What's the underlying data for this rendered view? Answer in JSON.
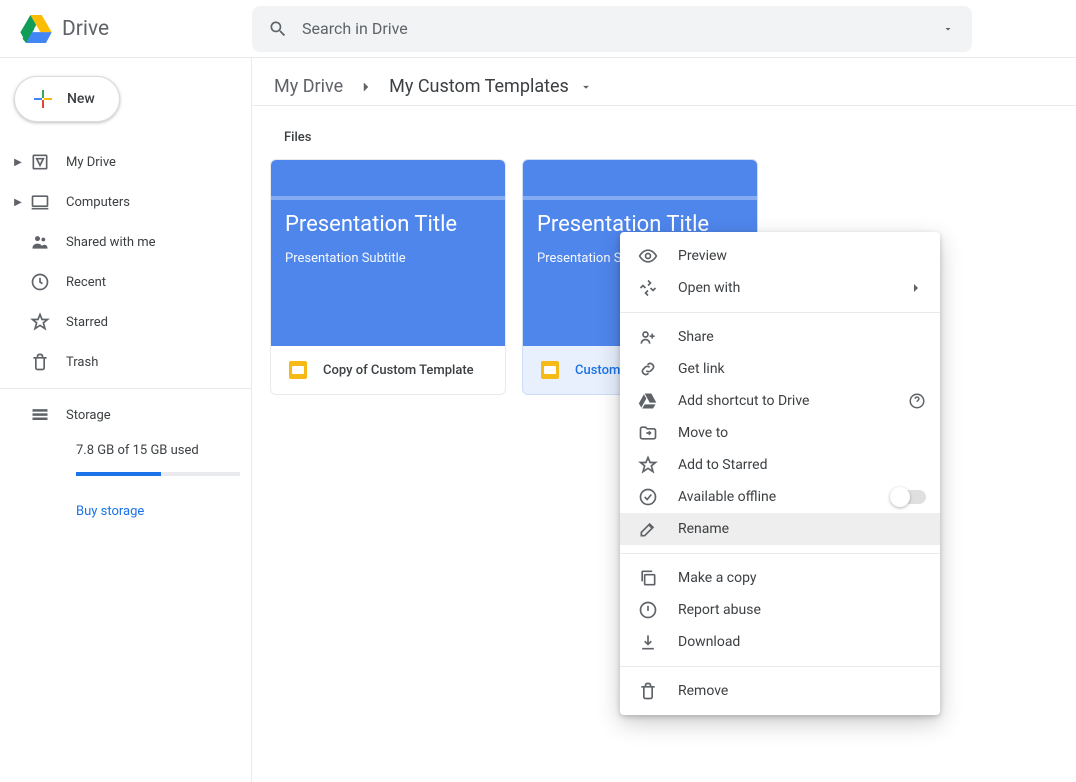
{
  "header": {
    "logo_text": "Drive",
    "search_placeholder": "Search in Drive"
  },
  "sidebar": {
    "new_label": "New",
    "items": [
      {
        "label": "My Drive",
        "expander": true
      },
      {
        "label": "Computers",
        "expander": true
      },
      {
        "label": "Shared with me",
        "expander": false
      },
      {
        "label": "Recent",
        "expander": false
      },
      {
        "label": "Starred",
        "expander": false
      },
      {
        "label": "Trash",
        "expander": false
      }
    ],
    "storage": {
      "label": "Storage",
      "usage_text": "7.8 GB of 15 GB used",
      "percent": 52,
      "buy_label": "Buy storage"
    }
  },
  "breadcrumb": {
    "root": "My Drive",
    "current": "My Custom Templates"
  },
  "files": {
    "section_label": "Files",
    "items": [
      {
        "name": "Copy of Custom Template",
        "thumb_title": "Presentation Title",
        "thumb_subtitle": "Presentation Subtitle",
        "selected": false
      },
      {
        "name": "Custom Template",
        "thumb_title": "Presentation Title",
        "thumb_subtitle": "Presentation Subtitle",
        "selected": true
      }
    ]
  },
  "context_menu": {
    "preview": "Preview",
    "open_with": "Open with",
    "share": "Share",
    "get_link": "Get link",
    "add_shortcut": "Add shortcut to Drive",
    "move_to": "Move to",
    "add_to_starred": "Add to Starred",
    "available_offline": "Available offline",
    "rename": "Rename",
    "make_a_copy": "Make a copy",
    "report_abuse": "Report abuse",
    "download": "Download",
    "remove": "Remove"
  }
}
